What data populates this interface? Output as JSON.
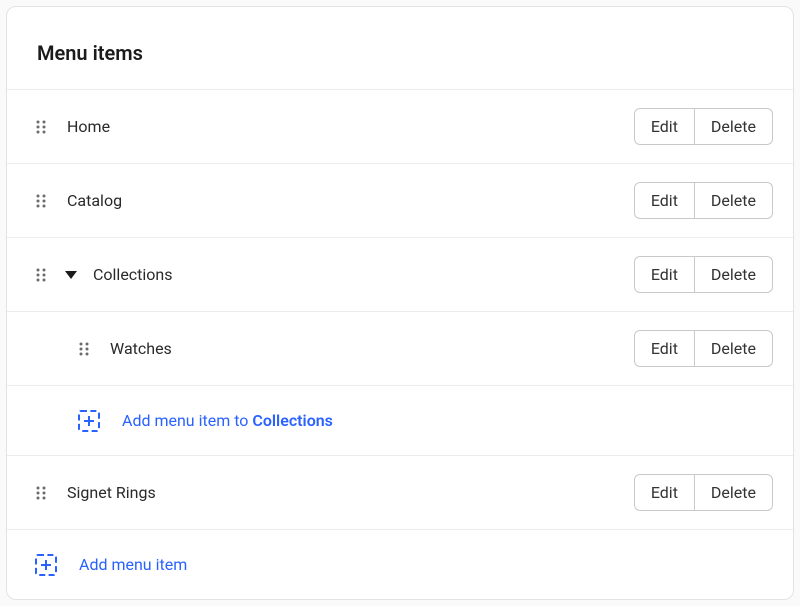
{
  "card": {
    "title": "Menu items"
  },
  "buttons": {
    "edit": "Edit",
    "delete": "Delete"
  },
  "items": {
    "home": {
      "label": "Home"
    },
    "catalog": {
      "label": "Catalog"
    },
    "collections": {
      "label": "Collections"
    },
    "watches": {
      "label": "Watches"
    },
    "signet": {
      "label": "Signet Rings"
    }
  },
  "add": {
    "nested_prefix": "Add menu item to ",
    "nested_target": "Collections",
    "root": "Add menu item"
  }
}
